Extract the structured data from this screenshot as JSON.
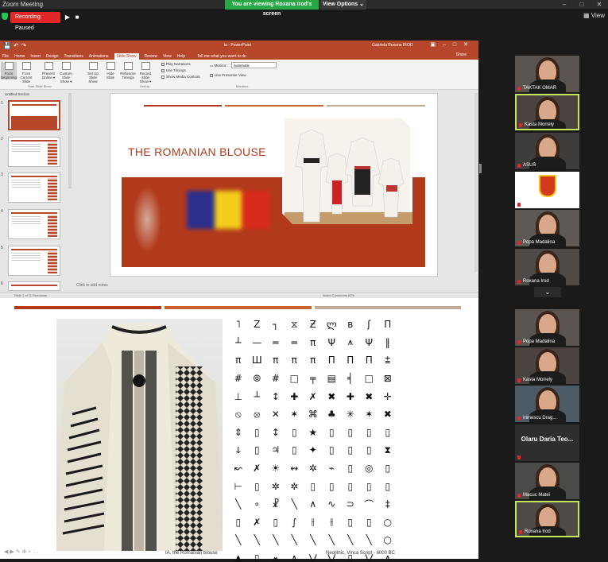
{
  "window": {
    "title": "Zoom Meeting",
    "controls": [
      "–",
      "□",
      "✕"
    ]
  },
  "meeting": {
    "recording_label": "Recording Paused",
    "resume_icon": "play-icon",
    "stop_icon": "stop-icon",
    "viewing_banner": "You are viewing Roxana Irod's screen",
    "view_options": "View Options ⌄",
    "view_label": "View"
  },
  "powerpoint": {
    "filename": "ia - PowerPoint",
    "user": "Gabriela Roxana IROD",
    "menu": [
      "File",
      "Home",
      "Insert",
      "Design",
      "Transitions",
      "Animations",
      "Slide Show",
      "Review",
      "View",
      "Help"
    ],
    "active_tab": "Slide Show",
    "tell_me": "Tell me what you want to do",
    "share": "Share",
    "ribbon_buttons": [
      {
        "label": "From Beginning"
      },
      {
        "label": "From Current Slide"
      },
      {
        "label": "Present Online ▾"
      },
      {
        "label": "Custom Slide Show ▾"
      },
      {
        "label": "Set Up Slide Show"
      },
      {
        "label": "Hide Slide"
      },
      {
        "label": "Rehearse Timings"
      },
      {
        "label": "Record Slide Show ▾"
      }
    ],
    "checkboxes": [
      "Play Narrations",
      "Use Timings",
      "Show Media Controls"
    ],
    "groups": [
      "Start Slide Show",
      "Set Up",
      "Monitors"
    ],
    "monitor_label": "Monitor:",
    "monitor_value": "Automatic",
    "presenter_view": "Use Presenter View",
    "section": "Untitled Section",
    "slide_numbers": [
      "1",
      "2",
      "3",
      "4",
      "5",
      "6"
    ],
    "slide_title": "THE ROMANIAN BLOUSE",
    "add_notes": "Click to add notes",
    "status_left": "Slide 1 of 11   Romanian",
    "status_right": "Notes   Comments   62%"
  },
  "lower": {
    "caption_left": "IA, the Romanian blouse",
    "caption_right": "Neolithic, Vinca Script - 6000 BC",
    "glyph_rows": [
      [
        "˥",
        "Z",
        "┐",
        "⧖",
        "Ƶ",
        "ლ",
        "ʙ",
        "ʃ",
        "Π"
      ],
      [
        "┴",
        "—",
        "═",
        "═",
        "π",
        "Ψ",
        "⩚",
        "Ψ",
        "‖"
      ],
      [
        "π",
        "Ш",
        "π",
        "π",
        "π",
        "Π",
        "Π",
        "Π",
        "⩲"
      ],
      [
        "#",
        "⦾",
        "#",
        "□",
        "╤",
        "▤",
        "╡",
        "□",
        "⊠"
      ],
      [
        "⊥",
        "┴",
        "↕",
        "✚",
        "✗",
        "✖",
        "✚",
        "✖",
        "✛"
      ],
      [
        "⦸",
        "⦻",
        "✕",
        "✶",
        "⌘",
        "♣",
        "✳",
        "✶",
        "✖"
      ],
      [
        "⇕",
        "▯",
        "↕",
        "▯",
        "★",
        "▯",
        "▯",
        "▯",
        "▯"
      ],
      [
        "ↆ",
        "▯",
        "♃",
        "▯",
        "✦",
        "▯",
        "▯",
        "▯",
        "⧗"
      ],
      [
        "↜",
        "✗",
        "☀",
        "↭",
        "✲",
        "⌁",
        "▯",
        "◎",
        "▯"
      ],
      [
        "⊢",
        "▯",
        "✲",
        "✲",
        "▯",
        "▯",
        "▯",
        "▯",
        "▯"
      ],
      [
        "╲",
        "∘",
        "☧",
        "╲",
        "∧",
        "∿",
        "⊃",
        "⌒",
        "‡"
      ],
      [
        "▯",
        "✗",
        "▯",
        "∫",
        "⫲",
        "⫲",
        "▯",
        "▯",
        "○"
      ],
      [
        "╲",
        "╲",
        "╲",
        "╲",
        "╲",
        "╲",
        "╲",
        "╲",
        "○"
      ],
      [
        "▲",
        "▯",
        "⩕",
        "∧",
        "⋁",
        "⋁",
        "▯",
        "⋁",
        "∧"
      ]
    ]
  },
  "participants": [
    {
      "name": "TAKTAK OMAR",
      "muted": true,
      "highlight": false
    },
    {
      "name": "Kasta Morrely",
      "muted": true,
      "highlight": true
    },
    {
      "name": "ASUS",
      "muted": true,
      "highlight": false
    },
    {
      "name": "Diana Morelli",
      "muted": true,
      "highlight": false
    },
    {
      "name": "Popa Madalina",
      "muted": true,
      "highlight": false
    },
    {
      "name": "Roxana Irod",
      "muted": true,
      "highlight": false
    },
    {
      "name": "Popa Madalina",
      "muted": true,
      "highlight": false
    },
    {
      "name": "Kasta Morrely",
      "muted": true,
      "highlight": false
    },
    {
      "name": "Irimescu Drag...",
      "muted": true,
      "highlight": false
    },
    {
      "name": "Olaru Daria Teo...",
      "muted": true,
      "highlight": false
    },
    {
      "name": "Macuc Matei",
      "muted": true,
      "highlight": false
    },
    {
      "name": "Roxana Irod",
      "muted": true,
      "highlight": true
    }
  ],
  "colors": {
    "accent": "#b7472a",
    "zoom_green": "#27a844",
    "rec_red": "#e02828",
    "highlight": "#c8e65a"
  }
}
